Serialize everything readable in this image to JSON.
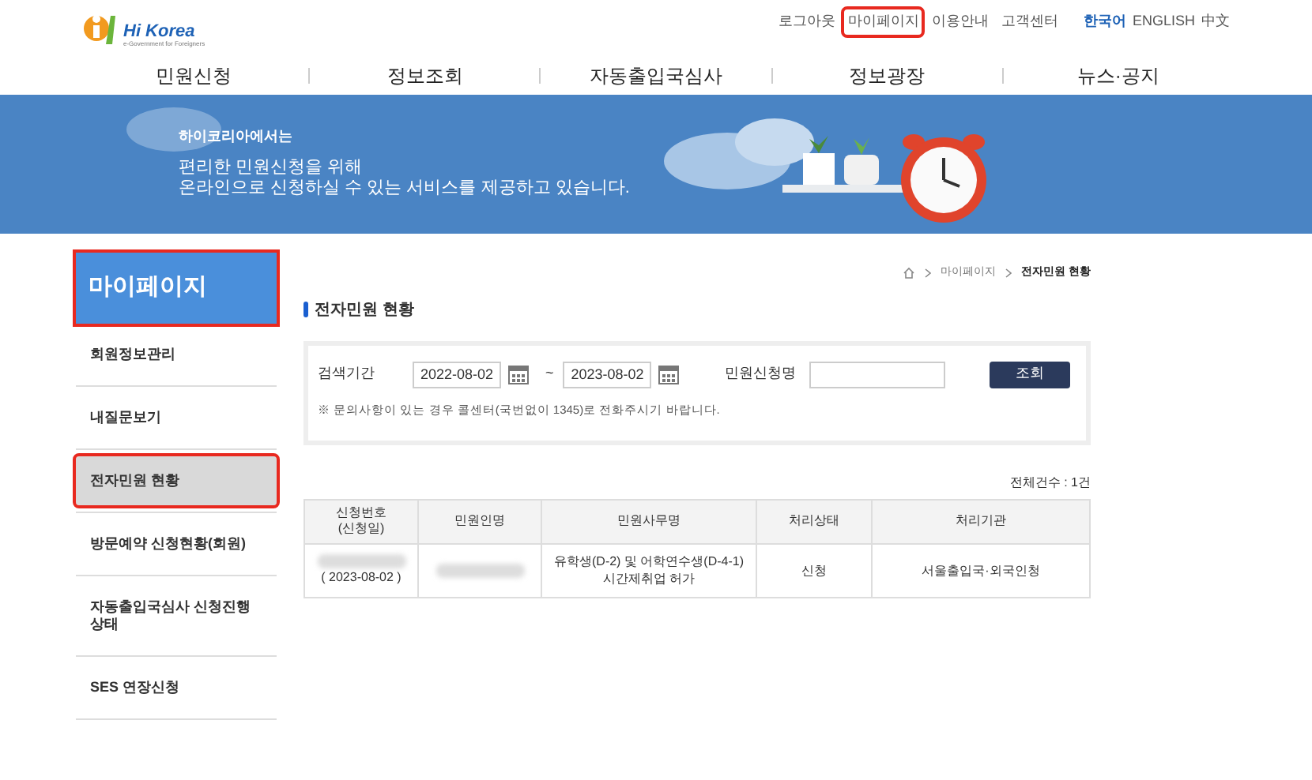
{
  "logo": {
    "text": "Hi Korea",
    "tagline": "e-Government for Foreigners"
  },
  "top_links": [
    {
      "label": "로그아웃",
      "annotated": false
    },
    {
      "label": "마이페이지",
      "annotated": true
    },
    {
      "label": "이용안내",
      "annotated": false
    },
    {
      "label": "고객센터",
      "annotated": false
    }
  ],
  "languages": [
    {
      "label": "한국어",
      "selected": true
    },
    {
      "label": "ENGLISH",
      "selected": false
    },
    {
      "label": "中文",
      "selected": false
    }
  ],
  "main_nav": [
    "민원신청",
    "정보조회",
    "자동출입국심사",
    "정보광장",
    "뉴스·공지"
  ],
  "banner": {
    "kicker": "하이코리아에서는",
    "lines": [
      "편리한 민원신청을 위해",
      "온라인으로 신청하실 수 있는 서비스를 제공하고 있습니다."
    ]
  },
  "sidebar": {
    "title": "마이페이지",
    "title_annotated": true,
    "items": [
      {
        "label": "회원정보관리",
        "selected": false,
        "annotated": false
      },
      {
        "label": "내질문보기",
        "selected": false,
        "annotated": false
      },
      {
        "label": "전자민원 현황",
        "selected": true,
        "annotated": true
      },
      {
        "label": "방문예약 신청현황(회원)",
        "selected": false,
        "annotated": false
      },
      {
        "label": "자동출입국심사 신청진행 상태",
        "selected": false,
        "annotated": false
      },
      {
        "label": "SES 연장신청",
        "selected": false,
        "annotated": false
      }
    ]
  },
  "breadcrumb": [
    "마이페이지",
    "전자민원 현황"
  ],
  "page_title": "전자민원 현황",
  "search": {
    "period_label": "검색기간",
    "from": "2022-08-02",
    "separator": "~",
    "to": "2023-08-02",
    "name_label": "민원신청명",
    "button": "조회",
    "note": "※ 문의사항이 있는 경우 콜센터(국번없이 1345)로 전화주시기 바랍니다."
  },
  "total": "전체건수 : 1건",
  "table": {
    "columns": [
      "신청번호\n(신청일)",
      "민원인명",
      "민원사무명",
      "처리상태",
      "처리기관"
    ],
    "rows": [
      [
        {
          "text": "( 2023-08-02 )",
          "redacted": true
        },
        {
          "text": "",
          "redacted": true
        },
        {
          "text": "유학생(D-2) 및 어학연수생(D-4-1)\n시간제취업 허가",
          "redacted": false
        },
        {
          "text": "신청",
          "redacted": false
        },
        {
          "text": "서울출입국·외국인청",
          "redacted": false
        }
      ]
    ]
  }
}
